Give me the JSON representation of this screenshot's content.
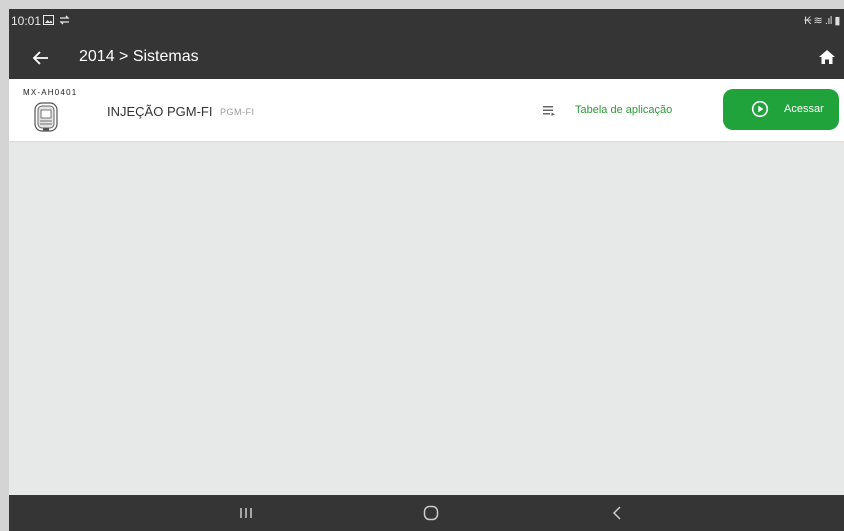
{
  "status_bar": {
    "time": "10:01",
    "right_icons": "₭ ≋ .ıl ▮"
  },
  "app_bar": {
    "title": "2014 > Sistemas"
  },
  "system_row": {
    "code": "MX-AH0401",
    "name": "INJEÇÃO PGM-FI",
    "subname": "PGM-FI",
    "application_table_label": "Tabela de aplicação",
    "access_label": "Acessar"
  },
  "colors": {
    "accent": "#20a33a",
    "bar": "#353535",
    "background": "#e7e8e8"
  },
  "icons": [
    "gallery-icon",
    "sync-icon",
    "back-arrow-icon",
    "home-icon",
    "ecu-module-icon",
    "list-icon",
    "play-circle-icon",
    "recent-apps-icon",
    "home-nav-icon",
    "back-nav-icon"
  ]
}
